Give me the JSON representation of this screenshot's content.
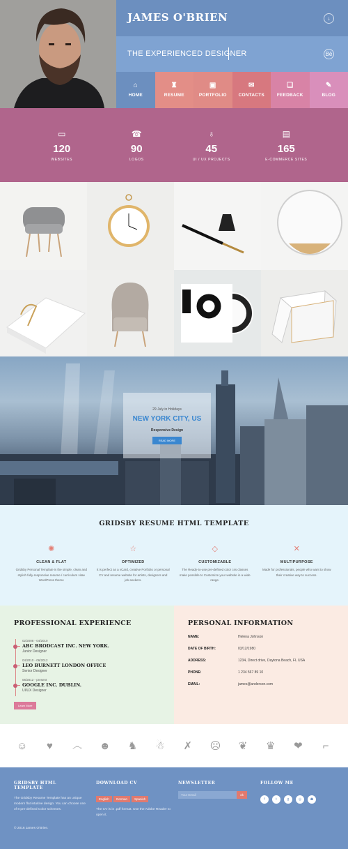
{
  "header": {
    "name": "JAMES O'BRIEN",
    "tagline": "THE EXPERIENCED DESIGNER",
    "download_icon": "arrow-down-icon",
    "behance_icon": "Bē",
    "nav": [
      {
        "label": "HOME",
        "icon": "home-icon",
        "glyph": "⌂",
        "color": "#6c8fbf"
      },
      {
        "label": "RESUME",
        "icon": "resume-icon",
        "glyph": "♜",
        "color": "#e38e87"
      },
      {
        "label": "PORTFOLIO",
        "icon": "portfolio-icon",
        "glyph": "▣",
        "color": "#e08b86"
      },
      {
        "label": "CONTACTS",
        "icon": "contacts-icon",
        "glyph": "✉",
        "color": "#d7787f"
      },
      {
        "label": "FEEDBACK",
        "icon": "feedback-icon",
        "glyph": "❏",
        "color": "#d883a6"
      },
      {
        "label": "BLOG",
        "icon": "blog-icon",
        "glyph": "✎",
        "color": "#d98fbb"
      }
    ]
  },
  "stats": [
    {
      "value": "120",
      "label": "WEBSITES",
      "icon": "monitor-icon",
      "glyph": "▭"
    },
    {
      "value": "90",
      "label": "LOGOS",
      "icon": "logo-icon",
      "glyph": "☎"
    },
    {
      "value": "45",
      "label": "UI / UX PROJECTS",
      "icon": "bulb-icon",
      "glyph": "♁"
    },
    {
      "value": "165",
      "label": "E-COMMERCE SITES",
      "icon": "wallet-icon",
      "glyph": "▤"
    }
  ],
  "portfolio": {
    "items": [
      "armchair",
      "pocket-watch",
      "fountain-pen",
      "round-mirror",
      "book",
      "lounge-chair",
      "vinyl-cover",
      "stool"
    ]
  },
  "city": {
    "meta": "29 July  in Holidays",
    "title": "NEW YORK CITY, US",
    "subtitle": "Responsive Design",
    "button": "READ MORE"
  },
  "features": {
    "title": "GRIDSBY RESUME HTML TEMPLATE",
    "items": [
      {
        "title": "CLEAN & FLAT",
        "icon": "sparkle-icon",
        "glyph": "✺",
        "desc": "Gridsby Personal Template is the simple, clean and stylish fully-responsive resume / curriculum vitae WordPress theme"
      },
      {
        "title": "OPTIMIZED",
        "icon": "star-icon",
        "glyph": "☆",
        "desc": "It is perfect as a vCard, creative Portfolio or personal CV and resume website for artists, designers and job-seekers."
      },
      {
        "title": "CUSTOMIZABLE",
        "icon": "diamond-icon",
        "glyph": "◇",
        "desc": "The Ready-to-use pre-defined color css classes make possible to Customize your website in a wide range."
      },
      {
        "title": "MULTIPURPOSE",
        "icon": "tools-icon",
        "glyph": "✕",
        "desc": "Made for professionals, people who want to show their creative way to success."
      }
    ]
  },
  "experience": {
    "title": "PROFESSIONAL EXPERIENCE",
    "items": [
      {
        "date": "02/2008 - 04/2010",
        "company": "ABC BRODCAST INC. NEW YORK.",
        "role": "Junior Designer"
      },
      {
        "date": "04/2010 - 06/2012",
        "company": "LEO BURNETT LONDON OFFICE",
        "role": "Senior Designer"
      },
      {
        "date": "06/2012 - present",
        "company": "GOOGLE INC. DUBLIN.",
        "role": "UI/UX Designer"
      }
    ],
    "button": "Learn More"
  },
  "info": {
    "title": "PERSONAL INFORMATION",
    "rows": [
      {
        "key": "NAME:",
        "value": "Helena Johnson"
      },
      {
        "key": "DATE OF BIRTH:",
        "value": "03/12/1980"
      },
      {
        "key": "ADDRESS:",
        "value": "1234, Direct drive, Daytona Beach, FL USA"
      },
      {
        "key": "PHONE:",
        "value": "1 234 567 89 10"
      },
      {
        "key": "EMAIL:",
        "value": "james@anderson.com"
      }
    ]
  },
  "icon_strip": [
    {
      "name": "smiley-badge-icon",
      "glyph": "☺"
    },
    {
      "name": "heart-icon",
      "glyph": "♥"
    },
    {
      "name": "mustache-icon",
      "glyph": "෴"
    },
    {
      "name": "nerd-face-icon",
      "glyph": "☻"
    },
    {
      "name": "rabbit-icon",
      "glyph": "♞"
    },
    {
      "name": "bearded-man-icon",
      "glyph": "☃"
    },
    {
      "name": "crossed-arrows-icon",
      "glyph": "✗"
    },
    {
      "name": "hipster-face-icon",
      "glyph": "☹"
    },
    {
      "name": "bear-icon",
      "glyph": "❦"
    },
    {
      "name": "hat-icon",
      "glyph": "♛"
    },
    {
      "name": "lips-icon",
      "glyph": "❤"
    },
    {
      "name": "pipe-icon",
      "glyph": "⌐"
    }
  ],
  "footer": {
    "col1_title": "GRIDSBY HTML TEMPLATE",
    "col1_text": "The Gridsby Resume Template has an unique modern flat intuitive design. You can choose one of 8 pre-defined Color schemes.",
    "col2_title": "DOWNLOAD CV",
    "langs": [
      "English",
      "German",
      "Spanish"
    ],
    "col2_text": "The CV is in .pdf format. Use the Adobe Reader to open it.",
    "col3_title": "NEWSLETTER",
    "email_placeholder": "Your Email",
    "ok": "ok",
    "col4_title": "FOLLOW ME",
    "social": [
      "f",
      "t",
      "g",
      "◎",
      "☗"
    ],
    "copyright": "© 2016 James O'Brien."
  },
  "colors": {
    "name_bar": "#6c8fbf",
    "tag_bar": "#7fa3d2",
    "stats_bg": "#b0658c",
    "features_bg": "#e5f4fb",
    "footer_bg": "#6f92c3"
  }
}
